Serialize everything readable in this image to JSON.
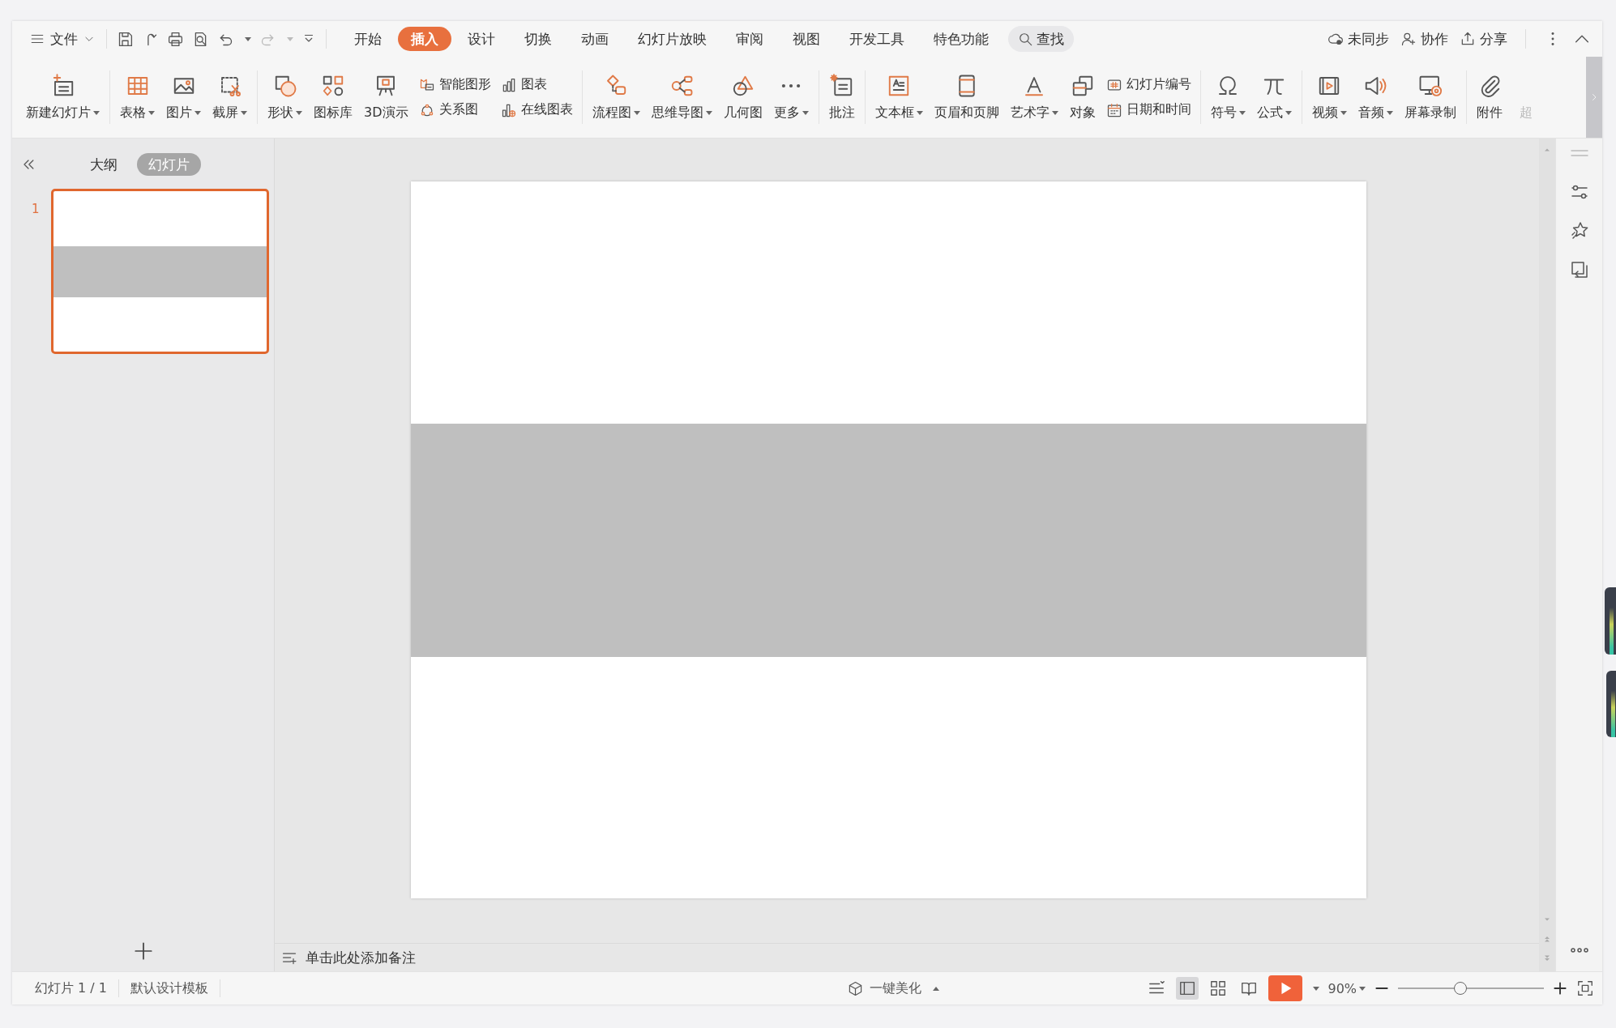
{
  "menu": {
    "file": "文件",
    "tabs": [
      {
        "label": "开始",
        "selected": false
      },
      {
        "label": "插入",
        "selected": true
      },
      {
        "label": "设计",
        "selected": false
      },
      {
        "label": "切换",
        "selected": false
      },
      {
        "label": "动画",
        "selected": false
      },
      {
        "label": "幻灯片放映",
        "selected": false
      },
      {
        "label": "审阅",
        "selected": false
      },
      {
        "label": "视图",
        "selected": false
      },
      {
        "label": "开发工具",
        "selected": false
      },
      {
        "label": "特色功能",
        "selected": false
      }
    ],
    "search": "查找",
    "actions": [
      "未同步",
      "协作",
      "分享"
    ]
  },
  "ribbon": {
    "groups": [
      [
        {
          "kind": "big",
          "label": "新建幻灯片",
          "dropdown": true,
          "disabled": false
        }
      ],
      [
        {
          "kind": "big",
          "label": "表格",
          "dropdown": true,
          "disabled": false
        },
        {
          "kind": "big",
          "label": "图片",
          "dropdown": true,
          "disabled": false
        },
        {
          "kind": "big",
          "label": "截屏",
          "dropdown": true,
          "disabled": false
        }
      ],
      [
        {
          "kind": "big",
          "label": "形状",
          "dropdown": true,
          "disabled": false
        },
        {
          "kind": "big",
          "label": "图标库",
          "dropdown": false,
          "disabled": false
        },
        {
          "kind": "big",
          "label": "3D演示",
          "dropdown": false,
          "disabled": false
        },
        {
          "kind": "stack",
          "items": [
            {
              "label": "智能图形"
            },
            {
              "label": "关系图"
            }
          ]
        },
        {
          "kind": "stack",
          "items": [
            {
              "label": "图表"
            },
            {
              "label": "在线图表"
            }
          ]
        }
      ],
      [
        {
          "kind": "big",
          "label": "流程图",
          "dropdown": true,
          "disabled": false
        },
        {
          "kind": "big",
          "label": "思维导图",
          "dropdown": true,
          "disabled": false
        },
        {
          "kind": "big",
          "label": "几何图",
          "dropdown": false,
          "disabled": false
        },
        {
          "kind": "big",
          "label": "更多",
          "dropdown": true,
          "disabled": false
        }
      ],
      [
        {
          "kind": "big",
          "label": "批注",
          "dropdown": false,
          "disabled": false
        }
      ],
      [
        {
          "kind": "big",
          "label": "文本框",
          "dropdown": true,
          "disabled": false
        },
        {
          "kind": "big",
          "label": "页眉和页脚",
          "dropdown": false,
          "disabled": false
        },
        {
          "kind": "big",
          "label": "艺术字",
          "dropdown": true,
          "disabled": false
        },
        {
          "kind": "big",
          "label": "对象",
          "dropdown": false,
          "disabled": false
        },
        {
          "kind": "stack",
          "items": [
            {
              "label": "幻灯片编号"
            },
            {
              "label": "日期和时间"
            }
          ]
        }
      ],
      [
        {
          "kind": "big",
          "label": "符号",
          "dropdown": true,
          "disabled": false
        },
        {
          "kind": "big",
          "label": "公式",
          "dropdown": true,
          "disabled": false
        }
      ],
      [
        {
          "kind": "big",
          "label": "视频",
          "dropdown": true,
          "disabled": false
        },
        {
          "kind": "big",
          "label": "音频",
          "dropdown": true,
          "disabled": false
        },
        {
          "kind": "big",
          "label": "屏幕录制",
          "dropdown": false,
          "disabled": false
        }
      ],
      [
        {
          "kind": "big",
          "label": "附件",
          "dropdown": false,
          "disabled": false
        },
        {
          "kind": "big",
          "label": "超",
          "dropdown": false,
          "disabled": true
        }
      ]
    ]
  },
  "panel": {
    "tabs": [
      {
        "label": "大纲",
        "selected": false
      },
      {
        "label": "幻灯片",
        "selected": true
      }
    ],
    "slides": [
      {
        "number": "1",
        "selected": true
      }
    ]
  },
  "notes": {
    "placeholder": "单击此处添加备注"
  },
  "status_bar": {
    "slide_info": "幻灯片 1 / 1",
    "template": "默认设计模板",
    "beautify": "一键美化",
    "views": [
      {
        "selected": true
      },
      {
        "selected": false
      },
      {
        "selected": false
      }
    ],
    "zoom": "90%",
    "level": 0.43
  }
}
